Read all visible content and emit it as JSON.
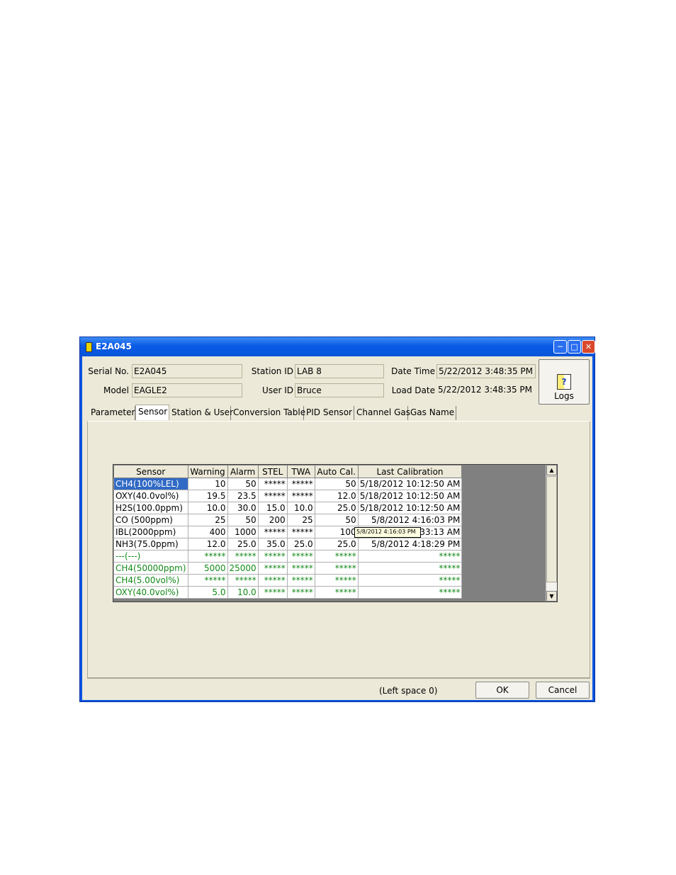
{
  "window": {
    "title": "E2A045"
  },
  "header": {
    "serial_label": "Serial No.",
    "serial_value": "E2A045",
    "model_label": "Model",
    "model_value": "EAGLE2",
    "station_label": "Station ID",
    "station_value": "LAB 8",
    "user_label": "User ID",
    "user_value": "Bruce",
    "datetime_label": "Date Time",
    "datetime_value": "5/22/2012 3:48:35 PM",
    "loaddate_label": "Load Date",
    "loaddate_value": "5/22/2012 3:48:35 PM",
    "logs_label": "Logs"
  },
  "tabs": [
    "Parameter",
    "Sensor",
    "Station & User",
    "Conversion Table",
    "PID Sensor",
    "Channel Gas",
    "Gas Name"
  ],
  "grid": {
    "columns": [
      "Sensor",
      "Warning",
      "Alarm",
      "STEL",
      "TWA",
      "Auto Cal.",
      "Last Calibration"
    ],
    "rows": [
      [
        "CH4(100%LEL)",
        "10",
        "50",
        "*****",
        "*****",
        "50",
        "5/18/2012 10:12:50 AM"
      ],
      [
        "OXY(40.0vol%)",
        "19.5",
        "23.5",
        "*****",
        "*****",
        "12.0",
        "5/18/2012 10:12:50 AM"
      ],
      [
        "H2S(100.0ppm)",
        "10.0",
        "30.0",
        "15.0",
        "10.0",
        "25.0",
        "5/18/2012 10:12:50 AM"
      ],
      [
        "CO (500ppm)",
        "25",
        "50",
        "200",
        "25",
        "50",
        "5/8/2012 4:16:03 PM"
      ],
      [
        "IBL(2000ppm)",
        "400",
        "1000",
        "*****",
        "*****",
        "100",
        "5/8/2012 10:33:13 AM"
      ],
      [
        "NH3(75.0ppm)",
        "12.0",
        "25.0",
        "35.0",
        "25.0",
        "25.0",
        "5/8/2012 4:18:29 PM"
      ],
      [
        "---(---)",
        "*****",
        "*****",
        "*****",
        "*****",
        "*****",
        "*****"
      ],
      [
        "CH4(50000ppm)",
        "5000",
        "25000",
        "*****",
        "*****",
        "*****",
        "*****"
      ],
      [
        "CH4(5.00vol%)",
        "*****",
        "*****",
        "*****",
        "*****",
        "*****",
        "*****"
      ],
      [
        "OXY(40.0vol%)",
        "5.0",
        "10.0",
        "*****",
        "*****",
        "*****",
        "*****"
      ]
    ],
    "tooltip": "5/8/2012 4:16:03 PM"
  },
  "status": {
    "left_space": "(Left space 0)",
    "ok_label": "OK",
    "cancel_label": "Cancel"
  }
}
